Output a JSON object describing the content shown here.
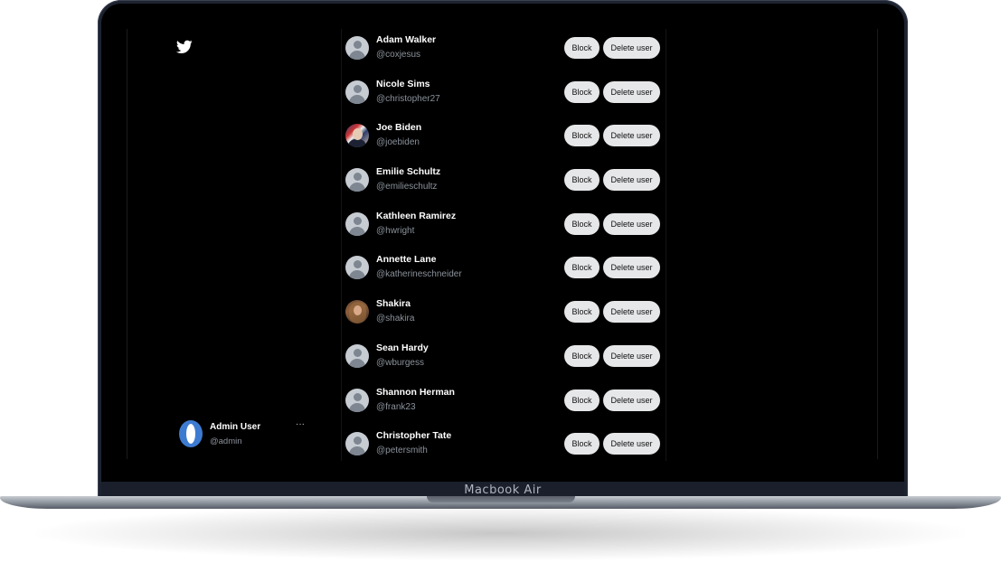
{
  "device": {
    "label": "Macbook Air"
  },
  "app": {
    "logo_icon": "twitter-bird-icon",
    "brand_color": "#ffffff"
  },
  "users": [
    {
      "name": "Adam Walker",
      "handle": "@coxjesus",
      "avatar": "default"
    },
    {
      "name": "Nicole Sims",
      "handle": "@christopher27",
      "avatar": "default"
    },
    {
      "name": "Joe Biden",
      "handle": "@joebiden",
      "avatar": "photo"
    },
    {
      "name": "Emilie Schultz",
      "handle": "@emilieschultz",
      "avatar": "default"
    },
    {
      "name": "Kathleen Ramirez",
      "handle": "@hwright",
      "avatar": "default"
    },
    {
      "name": "Annette Lane",
      "handle": "@katherineschneider",
      "avatar": "default"
    },
    {
      "name": "Shakira",
      "handle": "@shakira",
      "avatar": "photo"
    },
    {
      "name": "Sean Hardy",
      "handle": "@wburgess",
      "avatar": "default"
    },
    {
      "name": "Shannon Herman",
      "handle": "@frank23",
      "avatar": "default"
    },
    {
      "name": "Christopher Tate",
      "handle": "@petersmith",
      "avatar": "default"
    }
  ],
  "actions": {
    "block_label": "Block",
    "delete_label": "Delete user"
  },
  "account": {
    "name": "Admin User",
    "handle": "@admin",
    "more_label": "···"
  }
}
